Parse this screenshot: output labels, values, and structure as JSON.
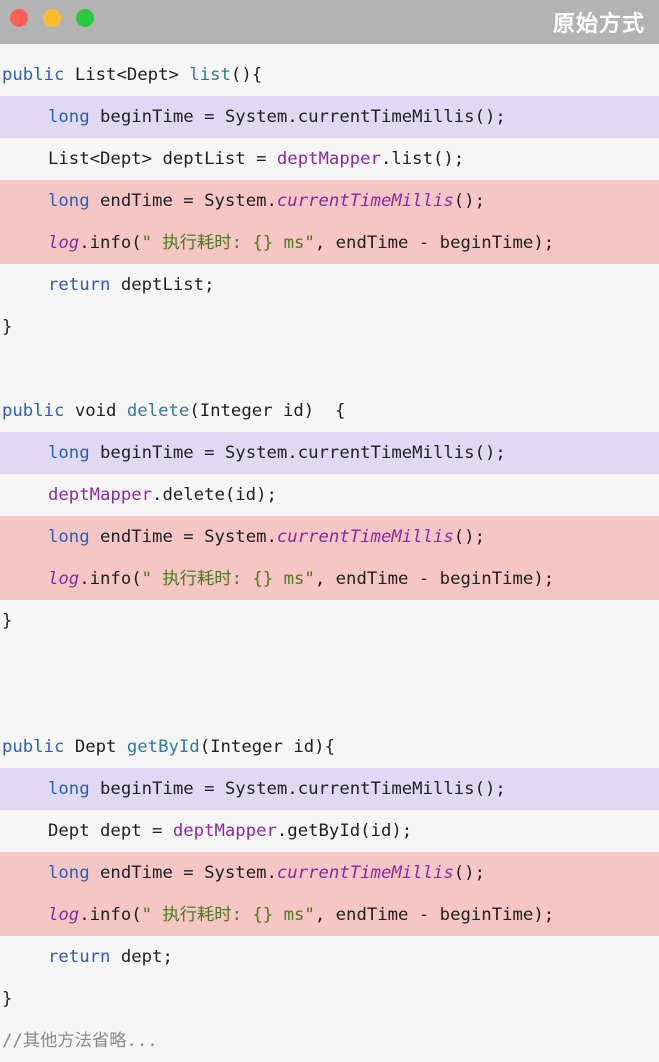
{
  "window": {
    "title": "原始方式"
  },
  "code": {
    "m1": {
      "sig_kw": "public",
      "sig_ret": " List<Dept> ",
      "sig_name": "list",
      "sig_tail": "(){",
      "begin_kw": "long",
      "begin_rest": " beginTime = System.currentTimeMillis();",
      "stmt_pre": "List<Dept> deptList = ",
      "stmt_field": "deptMapper",
      "stmt_post": ".list();",
      "end_kw": "long",
      "end_mid": " endTime = System.",
      "end_ital": "currentTimeMillis",
      "end_post": "();",
      "log_var": "log",
      "log_call": ".info(",
      "log_str": "\" 执行耗时: {} ms\"",
      "log_post": ", endTime - beginTime);",
      "ret_kw": "return",
      "ret_rest": " deptList;",
      "close": "}"
    },
    "m2": {
      "sig_kw": "public",
      "sig_ret": " void ",
      "sig_name": "delete",
      "sig_tail": "(Integer id)  {",
      "begin_kw": "long",
      "begin_rest": " beginTime = System.currentTimeMillis();",
      "stmt_field": "deptMapper",
      "stmt_post": ".delete(id);",
      "end_kw": "long",
      "end_mid": " endTime = System.",
      "end_ital": "currentTimeMillis",
      "end_post": "();",
      "log_var": "log",
      "log_call": ".info(",
      "log_str": "\" 执行耗时: {} ms\"",
      "log_post": ", endTime - beginTime);",
      "close": "}"
    },
    "m3": {
      "sig_kw": "public",
      "sig_ret": " Dept ",
      "sig_name": "getById",
      "sig_tail": "(Integer id){",
      "begin_kw": "long",
      "begin_rest": " beginTime = System.currentTimeMillis();",
      "stmt_pre": "Dept dept = ",
      "stmt_field": "deptMapper",
      "stmt_post": ".getById(id);",
      "end_kw": "long",
      "end_mid": " endTime = System.",
      "end_ital": "currentTimeMillis",
      "end_post": "();",
      "log_var": "log",
      "log_call": ".info(",
      "log_str": "\" 执行耗时: {} ms\"",
      "log_post": ", endTime - beginTime);",
      "ret_kw": "return",
      "ret_rest": " dept;",
      "close": "}"
    },
    "comment": "//其他方法省略..."
  },
  "colors": {
    "titlebar": "#b3b3b3",
    "highlight_begin": "#e0d9f5",
    "highlight_end": "#f5c6c4",
    "keyword": "#2c5fb0",
    "field": "#8a2aa3",
    "string": "#4a7a1f"
  }
}
